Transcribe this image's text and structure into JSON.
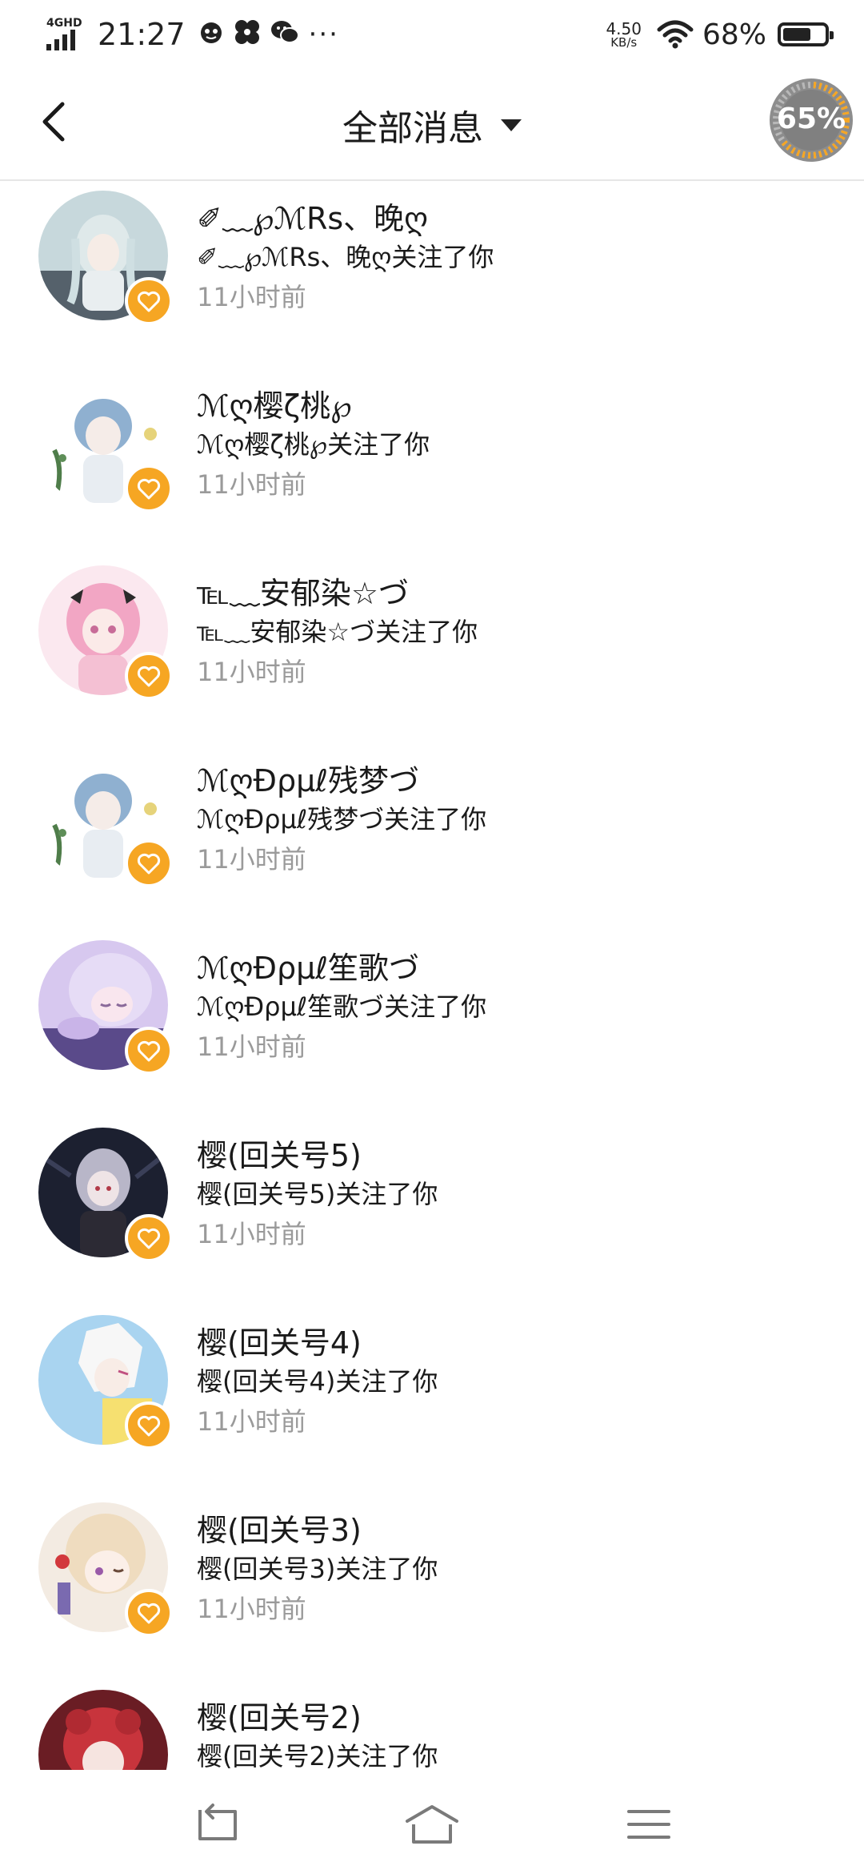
{
  "status_bar": {
    "network_label": "4GHD",
    "time": "21:27",
    "more": "···",
    "net_speed_value": "4.50",
    "net_speed_unit": "KB/s",
    "battery_percent_text": "68%",
    "battery_level": 0.68,
    "icons": [
      "signal-icon",
      "app-notify-icon",
      "fan-icon",
      "wechat-icon",
      "wifi-icon",
      "battery-icon"
    ]
  },
  "header": {
    "title": "全部消息",
    "back_icon": "chevron-left-icon",
    "dropdown_icon": "caret-down-icon",
    "boost_badge_text": "65%",
    "boost_level": 0.65
  },
  "messages": [
    {
      "name": "✐﹏℘ℳRs、晚ღ",
      "desc": "✐﹏℘ℳRs、晚ღ关注了你",
      "time": "11小时前"
    },
    {
      "name": "ℳღ樱ζ桃℘",
      "desc": "ℳღ樱ζ桃℘关注了你",
      "time": "11小时前"
    },
    {
      "name": "℡﹏安郁染☆づ",
      "desc": "℡﹏安郁染☆づ关注了你",
      "time": "11小时前"
    },
    {
      "name": "ℳღÐρμℓ残梦づ",
      "desc": "ℳღÐρμℓ残梦づ关注了你",
      "time": "11小时前"
    },
    {
      "name": "ℳღÐρμℓ笙歌づ",
      "desc": "ℳღÐρμℓ笙歌づ关注了你",
      "time": "11小时前"
    },
    {
      "name": "樱(回关号5)",
      "desc": "樱(回关号5)关注了你",
      "time": "11小时前"
    },
    {
      "name": "樱(回关号4)",
      "desc": "樱(回关号4)关注了你",
      "time": "11小时前"
    },
    {
      "name": "樱(回关号3)",
      "desc": "樱(回关号3)关注了你",
      "time": "11小时前"
    },
    {
      "name": "樱(回关号2)",
      "desc": "樱(回关号2)关注了你",
      "time": ""
    }
  ],
  "colors": {
    "badge_orange": "#f6a623",
    "time_gray": "#9a9a9a",
    "divider": "#e6e6e6",
    "nav_icon": "#7a7a7a"
  },
  "nav_bar": {
    "icons": [
      "back-nav-icon",
      "home-icon",
      "menu-icon"
    ]
  }
}
